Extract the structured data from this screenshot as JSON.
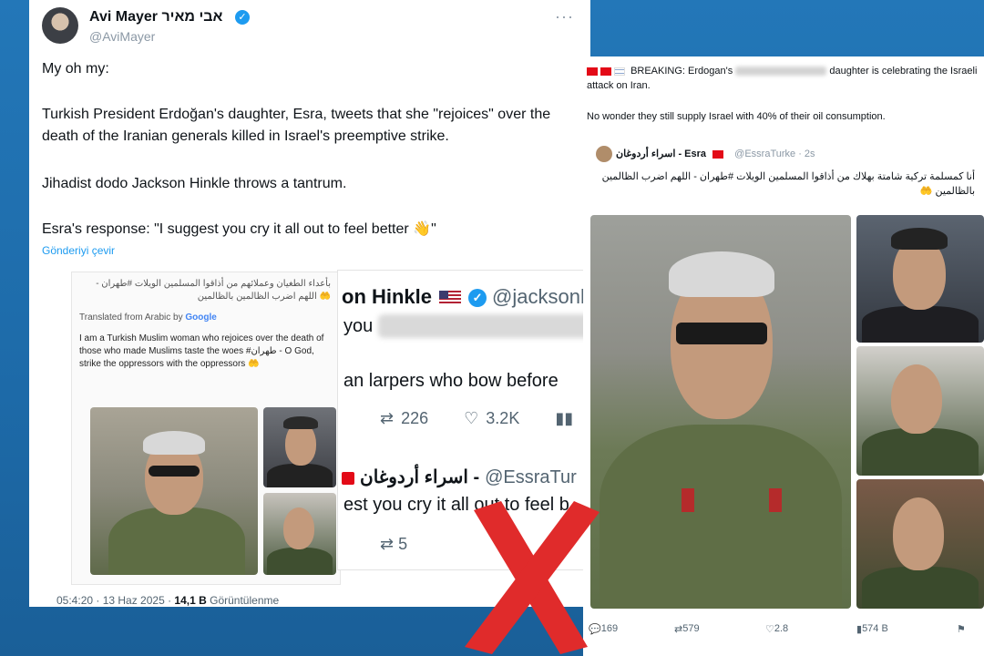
{
  "left_tweet": {
    "author_name": "Avi Mayer אבי מאיר",
    "author_handle": "@AviMayer",
    "more": "···",
    "verified": "✓",
    "line1": "My oh my:",
    "line2": "Turkish President Erdoğan's daughter, Esra, tweets that she \"rejoices\" over the death of the Iranian generals killed in Israel's preemptive strike.",
    "line3": "Jihadist dodo Jackson Hinkle throws a tantrum.",
    "line4": "Esra's response: \"I suggest you cry it all out to feel better 👋\"",
    "translate_link": "Gönderiyi çevir",
    "footer_time": "05:4:20 · 13 Haz 2025 · ",
    "footer_views": "14,1 B",
    "footer_views_label": " Görüntülenme"
  },
  "embed_left": {
    "arabic": "بأعداء الطغيان وعملائهم من أذاقوا المسلمين الويلات #طهران - اللهم اضرب الظالمين بالظالمين 🤲",
    "google_label": "Translated from Arabic by ",
    "google_brand": "Google",
    "translation": "I am a Turkish Muslim woman who rejoices over the death of those who made Muslims taste the woes #طهران - O God, strike the oppressors with the oppressors 🤲"
  },
  "embed_right": {
    "name1": "on Hinkle",
    "handle1": "@jacksonh",
    "you": "you",
    "line2": "an larpers who bow before",
    "retweets": "226",
    "likes": "3.2K",
    "name2": "اسراء أردوغان -",
    "handle2": "@EssraTur",
    "line3": "est you cry it all out to feel b",
    "retweets2": "5"
  },
  "right_tweet": {
    "breaking_prefix": "BREAKING: Erdogan's",
    "breaking_suffix": "daughter is celebrating the Israeli attack on Iran.",
    "wonder": "No wonder they still supply Israel with 40% of their oil consumption.",
    "quote_name": "اسراء أردوغان - Esra",
    "quote_handle": "@EssraTurke · 2s",
    "arabic": "أنا كمسلمة تركية شامتة بهلاك من أذاقوا المسلمين الويلات #طهران - اللهم اضرب الظالمين بالظالمين 🤲",
    "stats": [
      "169",
      "579",
      "2.8",
      "574 B"
    ]
  }
}
